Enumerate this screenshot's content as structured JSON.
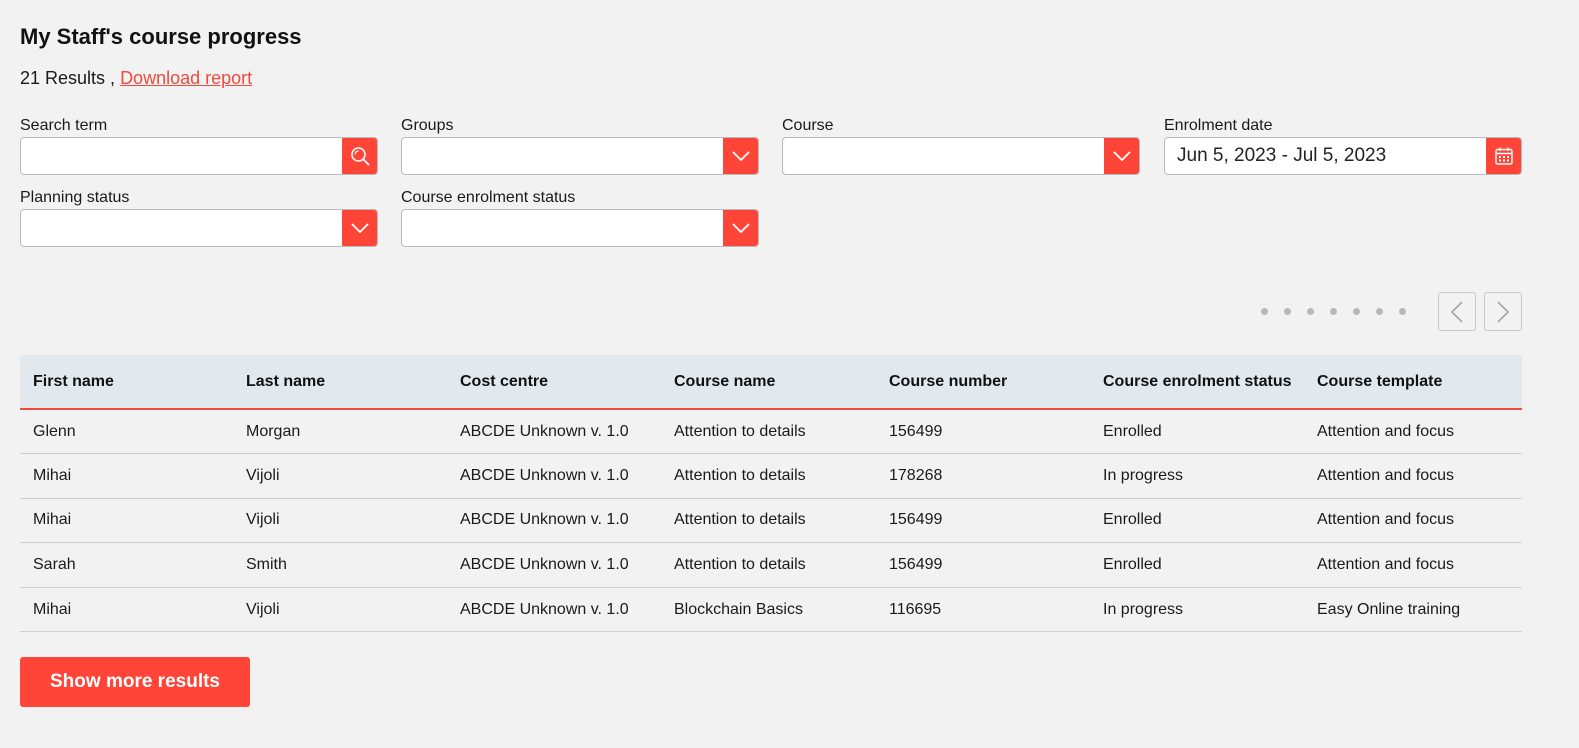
{
  "header": {
    "title": "My Staff's course progress",
    "results_count": "21 Results ,",
    "download_link": "Download report"
  },
  "filters": {
    "search_term": {
      "label": "Search term",
      "value": ""
    },
    "groups": {
      "label": "Groups",
      "value": ""
    },
    "course": {
      "label": "Course",
      "value": ""
    },
    "enrolment_date": {
      "label": "Enrolment date",
      "value": "Jun 5, 2023 - Jul 5, 2023"
    },
    "planning_status": {
      "label": "Planning status",
      "value": ""
    },
    "course_enrolment_status": {
      "label": "Course enrolment status",
      "value": ""
    }
  },
  "pager": {
    "dot_count": 7
  },
  "table": {
    "columns": [
      "First name",
      "Last name",
      "Cost centre",
      "Course name",
      "Course number",
      "Course enrolment status",
      "Course template"
    ],
    "rows": [
      [
        "Glenn",
        "Morgan",
        "ABCDE Unknown v. 1.0",
        "Attention to details",
        "156499",
        "Enrolled",
        "Attention and focus"
      ],
      [
        "Mihai",
        "Vijoli",
        "ABCDE Unknown v. 1.0",
        "Attention to details",
        "178268",
        "In progress",
        "Attention and focus"
      ],
      [
        "Mihai",
        "Vijoli",
        "ABCDE Unknown v. 1.0",
        "Attention to details",
        "156499",
        "Enrolled",
        "Attention and focus"
      ],
      [
        "Sarah",
        "Smith",
        "ABCDE Unknown v. 1.0",
        "Attention to details",
        "156499",
        "Enrolled",
        "Attention and focus"
      ],
      [
        "Mihai",
        "Vijoli",
        "ABCDE Unknown v. 1.0",
        "Blockchain Basics",
        "116695",
        "In progress",
        "Easy Online training"
      ]
    ]
  },
  "show_more_label": "Show more results",
  "colors": {
    "accent": "#ff4438",
    "link": "#ee4a3d",
    "table_header_bg": "#e1e9ef",
    "page_bg": "#f2f2f2"
  },
  "icons": {
    "search": "search-icon",
    "dropdown": "chevron-down-icon",
    "calendar": "calendar-icon",
    "prev": "chevron-left-icon",
    "next": "chevron-right-icon"
  }
}
